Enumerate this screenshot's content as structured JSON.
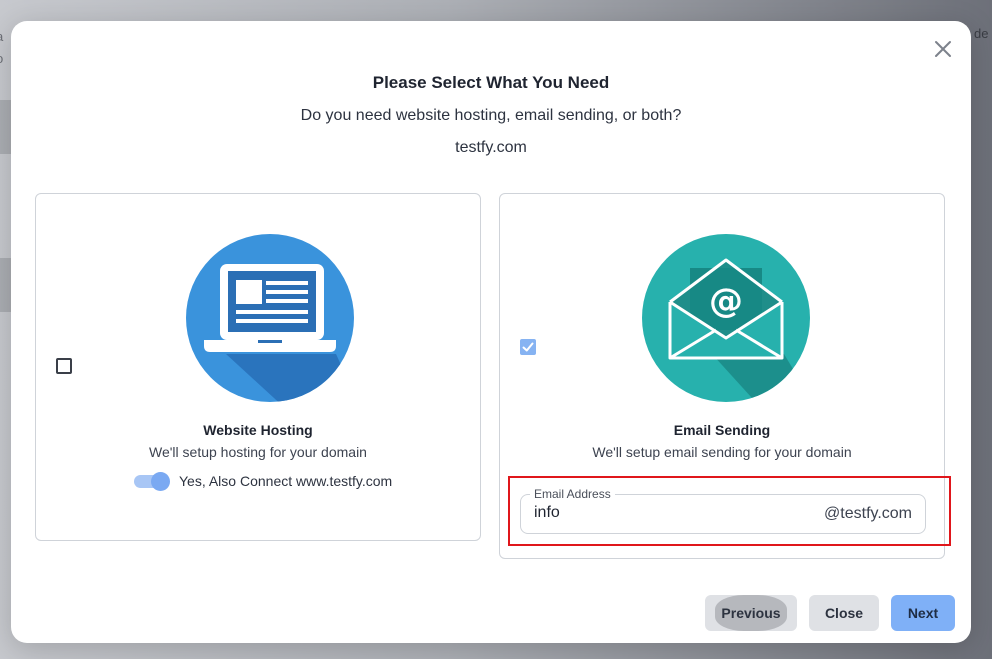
{
  "background": {
    "left_text": [
      "a",
      "o"
    ],
    "right_text": "de"
  },
  "modal": {
    "title": "Please Select What You Need",
    "subtitle": "Do you need website hosting, email sending, or both?",
    "domain": "testfy.com"
  },
  "cards": {
    "hosting": {
      "title": "Website Hosting",
      "description": "We'll setup hosting for your domain",
      "checked": false,
      "icon": "laptop-icon",
      "toggle_label": "Yes, Also Connect www.testfy.com",
      "toggle_on": true
    },
    "email": {
      "title": "Email Sending",
      "description": "We'll setup email sending for your domain",
      "checked": true,
      "icon": "envelope-at-icon",
      "field_label": "Email Address",
      "field_value": "info",
      "field_suffix": "@testfy.com"
    }
  },
  "buttons": {
    "previous": "Previous",
    "close": "Close",
    "next": "Next"
  },
  "colors": {
    "accent": "#7fb0f7",
    "highlight": "#e0161b",
    "hosting_circle": "#3a93dc",
    "email_circle": "#27b1ad"
  }
}
